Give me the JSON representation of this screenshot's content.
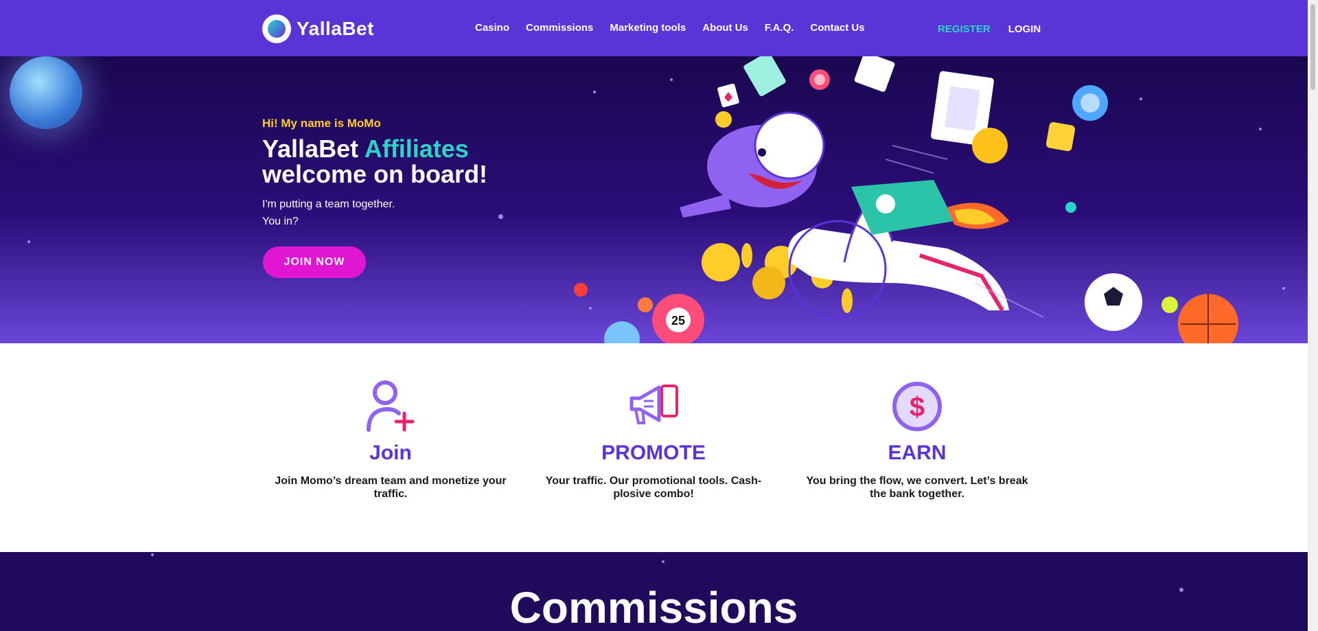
{
  "brand": {
    "name": "YallaBet"
  },
  "nav": {
    "items": [
      "Casino",
      "Commissions",
      "Marketing tools",
      "About Us",
      "F.A.Q.",
      "Contact Us"
    ]
  },
  "auth": {
    "register": "REGISTER",
    "login": "LOGIN"
  },
  "hero": {
    "subtitle": "Hi! My name is MoMo",
    "title_part1": "YallaBet ",
    "title_accent": "Affiliates",
    "title_part2": "welcome on board!",
    "text_line1": "I'm putting a team together.",
    "text_line2": "You in?",
    "cta": "JOIN NOW"
  },
  "steps": [
    {
      "title": "Join",
      "text": "Join Momo’s dream team  and monetize your traffic.",
      "icon": "add-user-icon"
    },
    {
      "title": "PROMOTE",
      "text": "Your traffic. Our promotional tools. Cash-plosive combo!",
      "icon": "megaphone-icon"
    },
    {
      "title": "EARN",
      "text": "You bring the flow, we convert. Let’s break the bank together.",
      "icon": "dollar-icon"
    }
  ],
  "commissions": {
    "title": "Commissions"
  },
  "colors": {
    "header": "#5b34d8",
    "accent": "#2bd3c9",
    "cta": "#e016d2",
    "gold": "#ffcd2a",
    "dark": "#1f0a5c"
  }
}
